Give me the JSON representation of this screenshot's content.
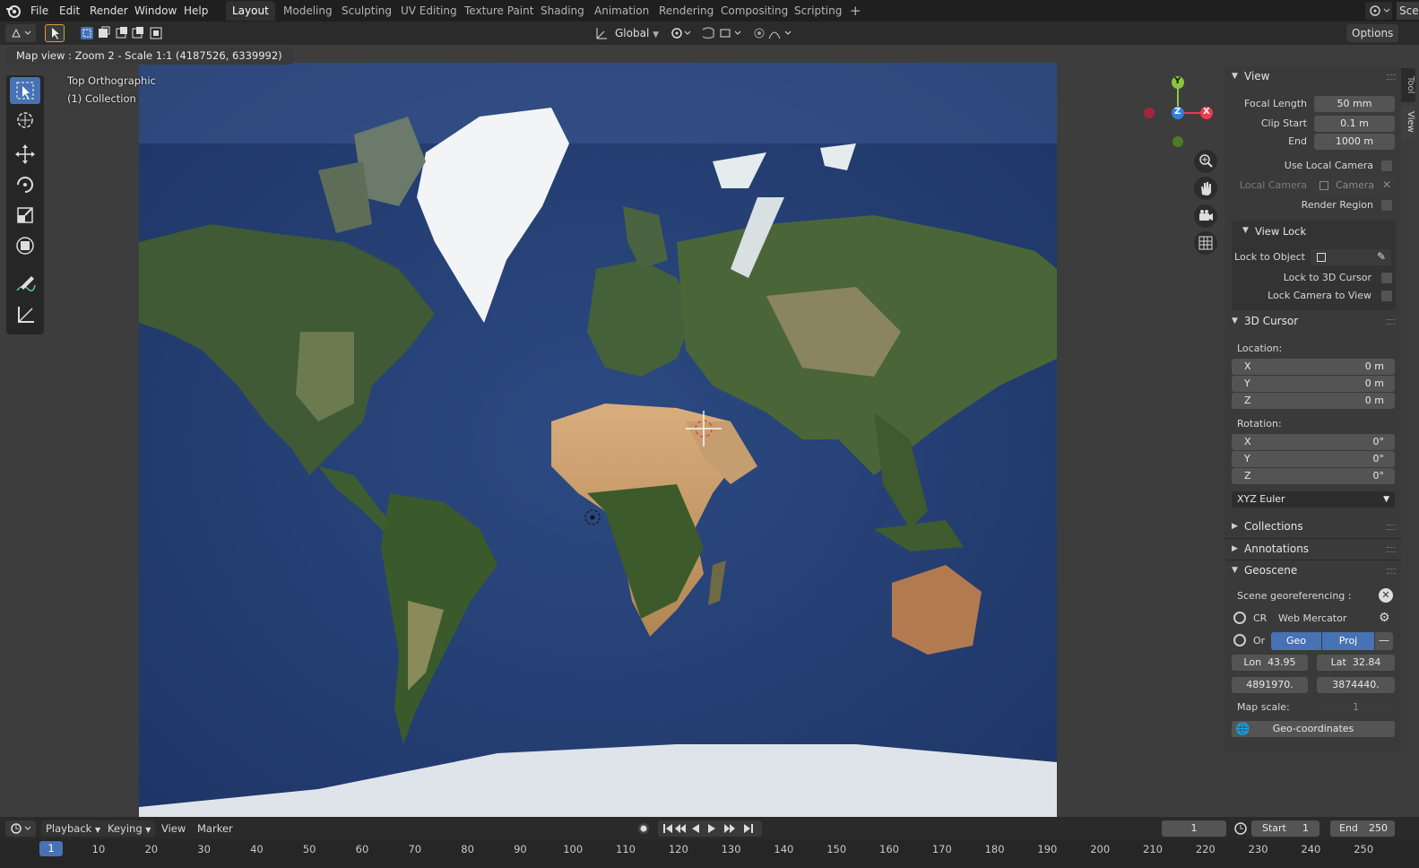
{
  "menu": {
    "file": "File",
    "edit": "Edit",
    "render": "Render",
    "window": "Window",
    "help": "Help"
  },
  "workspaces": [
    "Layout",
    "Modeling",
    "Sculpting",
    "UV Editing",
    "Texture Paint",
    "Shading",
    "Animation",
    "Rendering",
    "Compositing",
    "Scripting"
  ],
  "scene_label": "Scer",
  "header": {
    "orientation": "Global",
    "options": "Options"
  },
  "viewport": {
    "info": "Map view : Zoom 2 - Scale 1:1 (4187526, 6339992)",
    "view_name": "Top Orthographic",
    "collection": "(1) Collection",
    "gizmo": {
      "y": "Y",
      "z": "Z",
      "x": "X"
    }
  },
  "sidebar": {
    "tabs": [
      "Tool",
      "View"
    ],
    "view_panel": {
      "title": "View",
      "focal_length_label": "Focal Length",
      "focal_length": "50 mm",
      "clip_start_label": "Clip Start",
      "clip_start": "0.1 m",
      "end_label": "End",
      "end": "1000 m",
      "use_local_camera": "Use Local Camera",
      "local_camera_label": "Local Camera",
      "local_camera": "Camera",
      "render_region": "Render Region"
    },
    "view_lock": {
      "title": "View Lock",
      "lock_to_object": "Lock to Object",
      "lock_to_cursor": "Lock to 3D Cursor",
      "lock_camera": "Lock Camera to View"
    },
    "cursor_panel": {
      "title": "3D Cursor",
      "location": "Location:",
      "loc": [
        {
          "axis": "X",
          "value": "0 m"
        },
        {
          "axis": "Y",
          "value": "0 m"
        },
        {
          "axis": "Z",
          "value": "0 m"
        }
      ],
      "rotation": "Rotation:",
      "rot": [
        {
          "axis": "X",
          "value": "0°"
        },
        {
          "axis": "Y",
          "value": "0°"
        },
        {
          "axis": "Z",
          "value": "0°"
        }
      ],
      "mode": "XYZ Euler"
    },
    "collections": "Collections",
    "annotations": "Annotations",
    "geoscene": {
      "title": "Geoscene",
      "scene_georef": "Scene georeferencing :",
      "crs_label": "CR",
      "crs_value": "Web Mercator",
      "origin_label": "Or",
      "geo_btn": "Geo",
      "proj_btn": "Proj",
      "lon_label": "Lon",
      "lon": "43.95",
      "lat_label": "Lat",
      "lat": "32.84",
      "x_proj": "4891970.",
      "y_proj": "3874440.",
      "map_scale_label": "Map scale:",
      "map_scale": "1",
      "geo_coords_btn": "Geo-coordinates"
    }
  },
  "timeline": {
    "playback": "Playback",
    "keying": "Keying",
    "view": "View",
    "marker": "Marker",
    "current_frame": "1",
    "start_label": "Start",
    "start": "1",
    "end_label": "End",
    "end": "250",
    "ticks": [
      "1",
      "10",
      "20",
      "30",
      "40",
      "50",
      "60",
      "70",
      "80",
      "90",
      "100",
      "110",
      "120",
      "130",
      "140",
      "150",
      "160",
      "170",
      "180",
      "190",
      "200",
      "210",
      "220",
      "230",
      "240",
      "250"
    ]
  }
}
